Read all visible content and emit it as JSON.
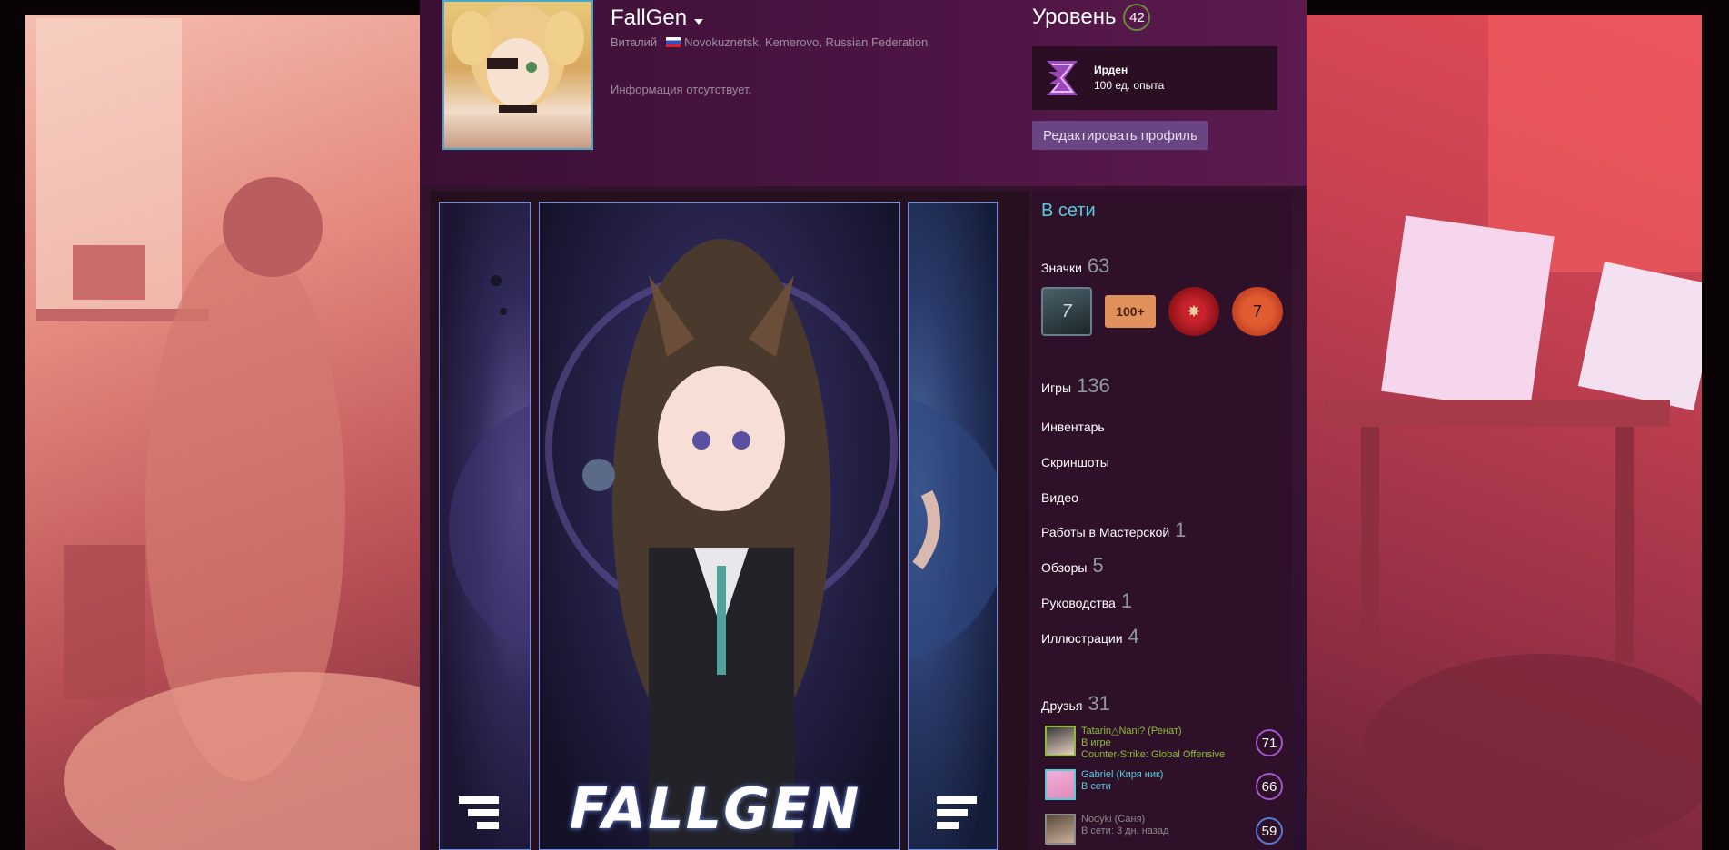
{
  "profile": {
    "persona_name": "FallGen",
    "real_name": "Виталий",
    "location": "Novokuznetsk, Kemerovo, Russian Federation",
    "summary": "Информация отсутствует."
  },
  "level": {
    "label": "Уровень",
    "value": "42"
  },
  "xp_badge": {
    "title": "Ирден",
    "xp": "100 ед. опыта"
  },
  "edit_profile_label": "Редактировать профиль",
  "showcase": {
    "art_title": "FALLGEN"
  },
  "sidebar": {
    "status": "В сети",
    "badges": {
      "label": "Значки",
      "count": "63"
    },
    "badge_items": [
      {
        "icon": "seven-badge-icon",
        "text": "7"
      },
      {
        "icon": "100-plus-badge-icon",
        "text": "100+"
      },
      {
        "icon": "wax-seal-badge-icon",
        "text": ""
      },
      {
        "icon": "gear-hammer-badge-icon",
        "text": "7"
      }
    ],
    "games": {
      "label": "Игры",
      "count": "136"
    },
    "inventory": {
      "label": "Инвентарь"
    },
    "screenshots": {
      "label": "Скриншоты"
    },
    "videos": {
      "label": "Видео"
    },
    "workshop": {
      "label": "Работы в Мастерской",
      "count": "1"
    },
    "reviews": {
      "label": "Обзоры",
      "count": "5"
    },
    "guides": {
      "label": "Руководства",
      "count": "1"
    },
    "artwork": {
      "label": "Иллюстрации",
      "count": "4"
    },
    "friends": {
      "label": "Друзья",
      "count": "31"
    }
  },
  "friends": [
    {
      "name": "Tatarin△Nani? (Ренат)",
      "status": "В игре",
      "game": "Counter-Strike: Global Offensive",
      "level": "71",
      "state": "in-game"
    },
    {
      "name": "Gabriel (Киря ник)",
      "status": "В сети",
      "game": "",
      "level": "66",
      "state": "online"
    },
    {
      "name": "Nodyki (Саня)",
      "status": "В сети: 3 дн. назад",
      "game": "",
      "level": "59",
      "state": "offline"
    }
  ],
  "colors": {
    "online": "#57cbde",
    "in_game": "#90ba3c",
    "offline": "#898989",
    "button": "#6a4583"
  }
}
